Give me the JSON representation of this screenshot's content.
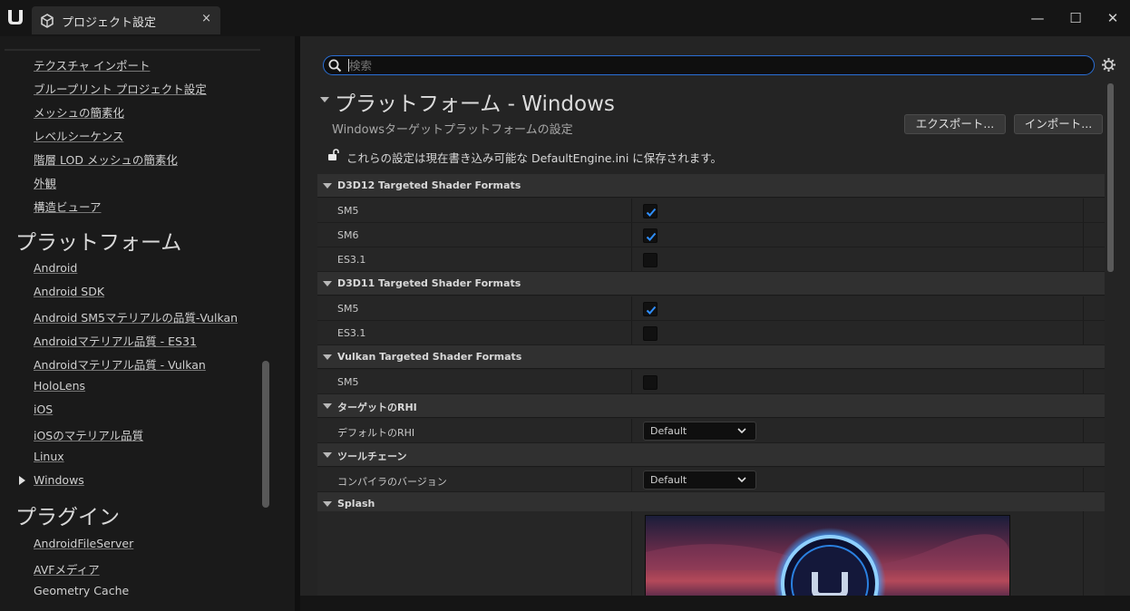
{
  "window": {
    "tab_title": "プロジェクト設定",
    "close_tab": "×",
    "minimize": "—",
    "maximize": "☐",
    "close": "✕"
  },
  "sidebar": {
    "links_top": [
      "テクスチャ インポート",
      "ブループリント プロジェクト設定",
      "メッシュの簡素化",
      "レベルシーケンス",
      "階層 LOD メッシュの簡素化",
      "外観",
      "構造ビューア"
    ],
    "platform_heading": "プラットフォーム",
    "platform_items": [
      "Android",
      "Android SDK",
      "Android SM5マテリアルの品質-Vulkan",
      "Androidマテリアル品質 - ES31",
      "Androidマテリアル品質 - Vulkan",
      "HoloLens",
      "iOS",
      "iOSのマテリアル品質",
      "Linux",
      "Windows"
    ],
    "selected": "Windows",
    "plugin_heading": "プラグイン",
    "plugin_items": [
      "AndroidFileServer",
      "AVFメディア",
      "Geometry Cache"
    ]
  },
  "search": {
    "placeholder": "検索"
  },
  "page": {
    "title": "プラットフォーム - Windows",
    "subtitle": "Windowsターゲットプラットフォームの設定",
    "export_label": "エクスポート...",
    "import_label": "インポート...",
    "save_note": "これらの設定は現在書き込み可能な DefaultEngine.ini に保存されます。"
  },
  "sections": {
    "d3d12": {
      "title": "D3D12 Targeted Shader Formats",
      "rows": [
        {
          "label": "SM5",
          "checked": true
        },
        {
          "label": "SM6",
          "checked": true
        },
        {
          "label": "ES3.1",
          "checked": false
        }
      ]
    },
    "d3d11": {
      "title": "D3D11 Targeted Shader Formats",
      "rows": [
        {
          "label": "SM5",
          "checked": true
        },
        {
          "label": "ES3.1",
          "checked": false
        }
      ]
    },
    "vulkan": {
      "title": "Vulkan Targeted Shader Formats",
      "rows": [
        {
          "label": "SM5",
          "checked": false
        }
      ]
    },
    "rhi": {
      "title": "ターゲットのRHI",
      "label": "デフォルトのRHI",
      "value": "Default"
    },
    "toolchain": {
      "title": "ツールチェーン",
      "label": "コンパイラのバージョン",
      "value": "Default"
    },
    "splash": {
      "title": "Splash"
    }
  },
  "colors": {
    "accent": "#2a6fd6",
    "check": "#2f8fff"
  }
}
